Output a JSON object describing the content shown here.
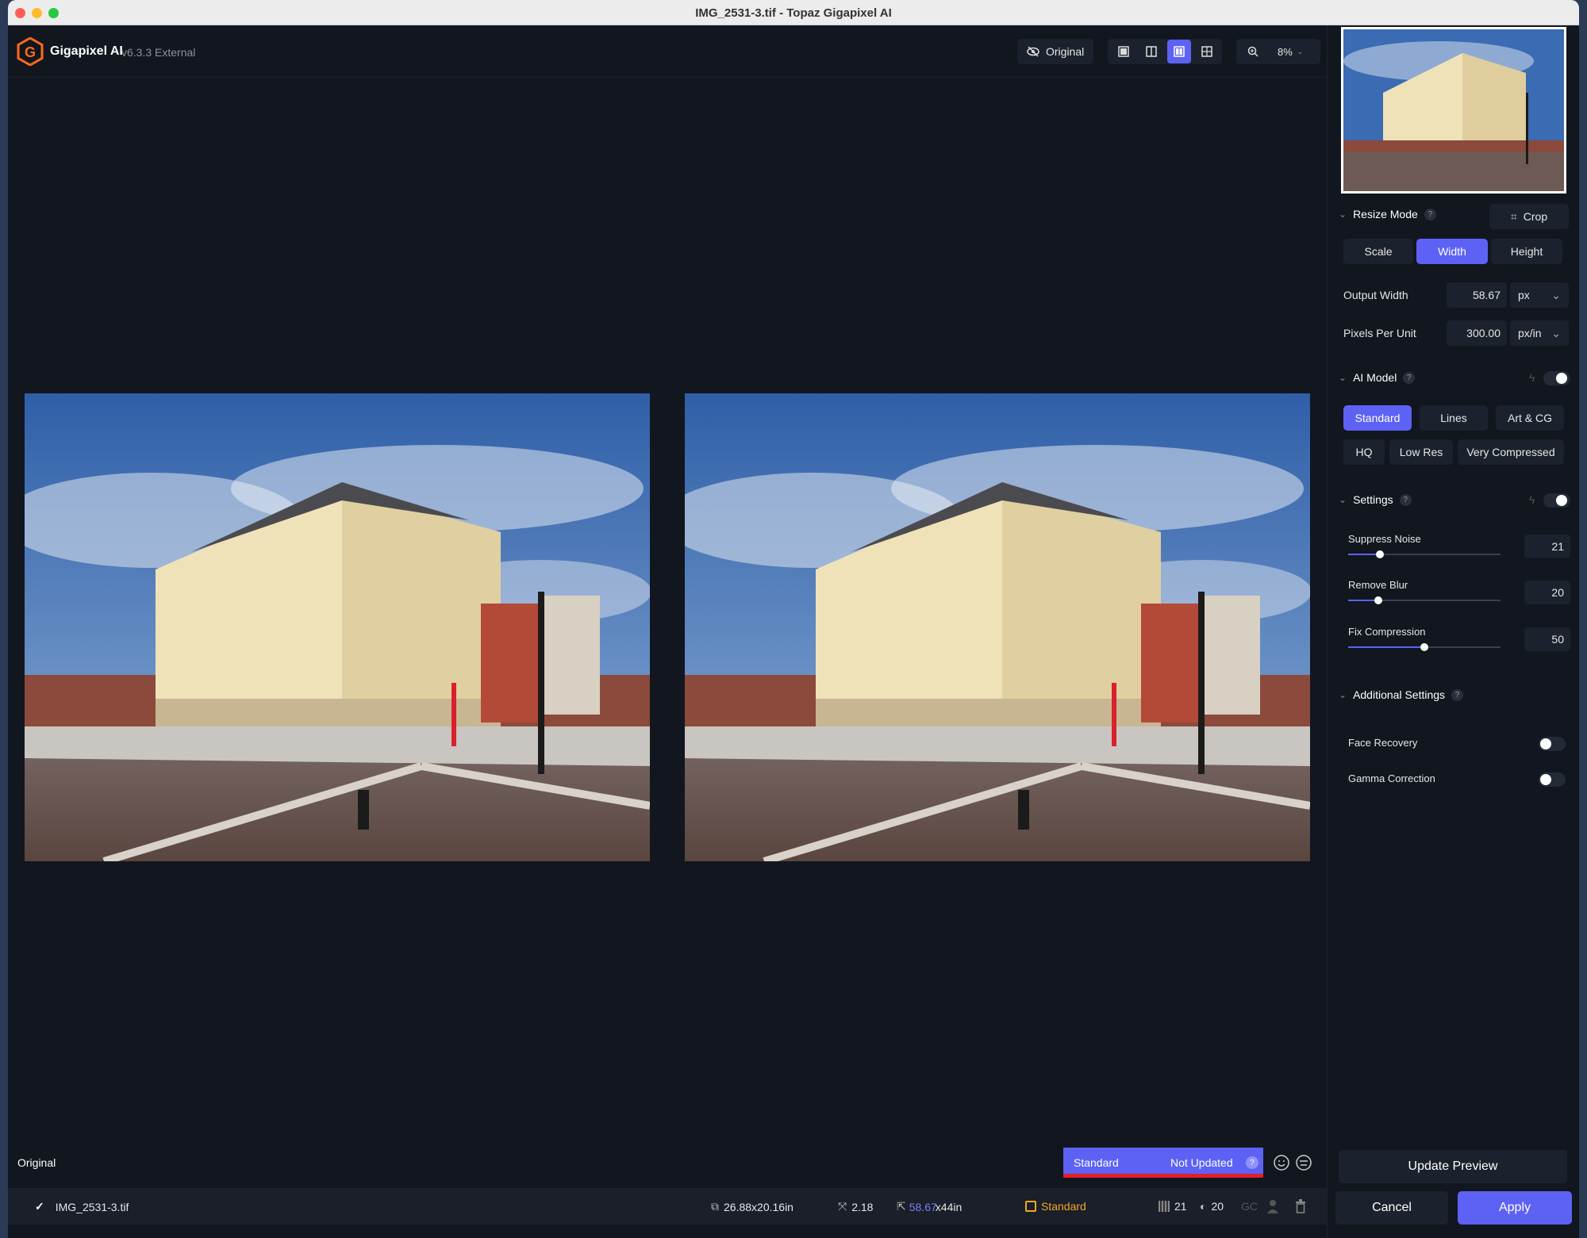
{
  "window": {
    "title": "IMG_2531-3.tif - Topaz Gigapixel AI"
  },
  "header": {
    "app_name": "Gigapixel AI",
    "version": "v6.3.3 External",
    "original_toggle": "Original",
    "zoom": "8%"
  },
  "viewer": {
    "original_label": "Original",
    "status_model": "Standard",
    "status_state": "Not Updated"
  },
  "filebar": {
    "filename": "IMG_2531-3.tif",
    "input_size": "26.88x20.16in",
    "scale": "2.18",
    "output_width": "58.67",
    "output_rest": "x44in",
    "model": "Standard",
    "noise": "21",
    "blur": "20",
    "gc": "GC"
  },
  "panel": {
    "resize_mode": {
      "title": "Resize Mode",
      "crop_label": "Crop",
      "modes": [
        "Scale",
        "Width",
        "Height"
      ],
      "active": "Width"
    },
    "output_width": {
      "label": "Output Width",
      "value": "58.67",
      "unit": "px"
    },
    "pixels_per_unit": {
      "label": "Pixels Per Unit",
      "value": "300.00",
      "unit": "px/in"
    },
    "ai_model": {
      "title": "AI Model",
      "models_row1": [
        "Standard",
        "Lines",
        "Art & CG"
      ],
      "models_row2": [
        "HQ",
        "Low Res",
        "Very Compressed"
      ],
      "active": "Standard"
    },
    "settings": {
      "title": "Settings",
      "sliders": [
        {
          "label": "Suppress Noise",
          "value": "21",
          "fraction": 0.21
        },
        {
          "label": "Remove Blur",
          "value": "20",
          "fraction": 0.2
        },
        {
          "label": "Fix Compression",
          "value": "50",
          "fraction": 0.5
        }
      ]
    },
    "additional": {
      "title": "Additional Settings",
      "face_recovery": "Face Recovery",
      "gamma_correction": "Gamma Correction"
    },
    "update_preview": "Update Preview",
    "cancel": "Cancel",
    "apply": "Apply"
  },
  "colors": {
    "accent": "#5d62f5",
    "warning": "#e0202b",
    "model_orange": "#f5a623"
  }
}
